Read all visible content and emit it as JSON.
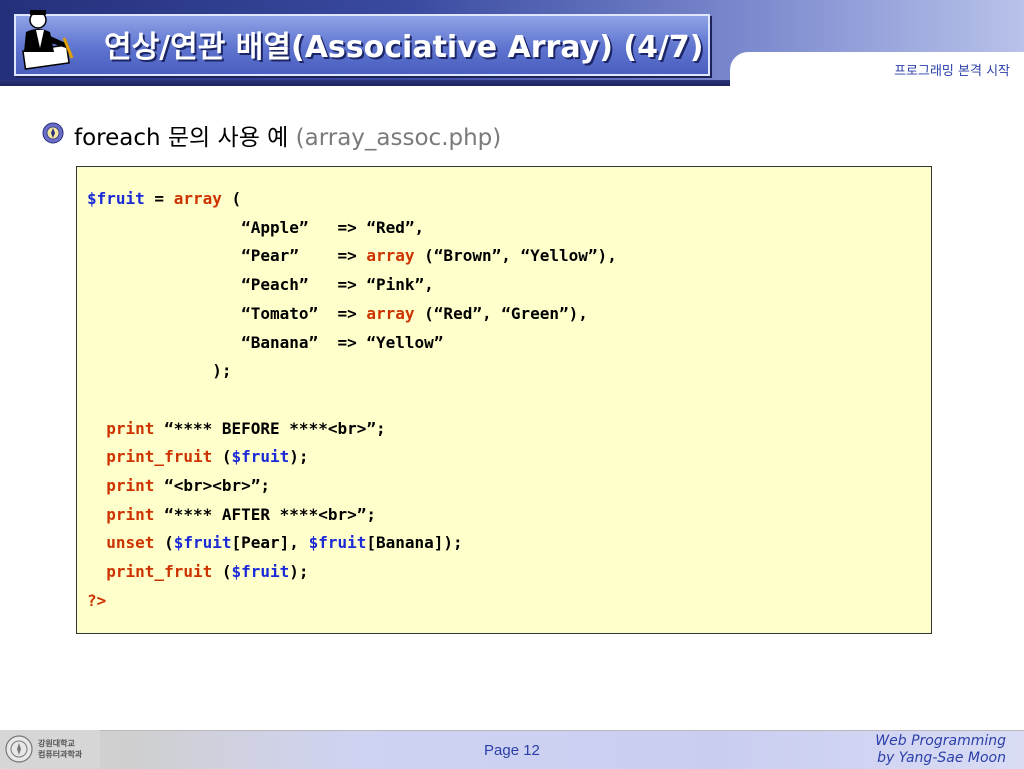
{
  "header": {
    "title": "연상/연관 배열(Associative Array) (4/7)",
    "subtitle": "프로그래밍 본격 시작"
  },
  "heading": {
    "text": "foreach 문의 사용 예",
    "file": "(array_assoc.php)"
  },
  "code_lines": [
    [
      {
        "t": "$fruit",
        "c": "var"
      },
      {
        "t": " = "
      },
      {
        "t": "array",
        "c": "kw"
      },
      {
        "t": " ("
      }
    ],
    [
      {
        "t": "                “Apple”   => “Red”,"
      }
    ],
    [
      {
        "t": "                “Pear”    => "
      },
      {
        "t": "array",
        "c": "kw"
      },
      {
        "t": " (“Brown”, “Yellow”),"
      }
    ],
    [
      {
        "t": "                “Peach”   => “Pink”,"
      }
    ],
    [
      {
        "t": "                “Tomato”  => "
      },
      {
        "t": "array",
        "c": "kw"
      },
      {
        "t": " (“Red”, “Green”),"
      }
    ],
    [
      {
        "t": "                “Banana”  => “Yellow”"
      }
    ],
    [
      {
        "t": "             );"
      }
    ],
    [
      {
        "t": ""
      }
    ],
    [
      {
        "t": "  "
      },
      {
        "t": "print",
        "c": "kw"
      },
      {
        "t": " “**** BEFORE ****<br>”;"
      }
    ],
    [
      {
        "t": "  "
      },
      {
        "t": "print_fruit",
        "c": "kw"
      },
      {
        "t": " ("
      },
      {
        "t": "$fruit",
        "c": "var"
      },
      {
        "t": ");"
      }
    ],
    [
      {
        "t": "  "
      },
      {
        "t": "print",
        "c": "kw"
      },
      {
        "t": " “<br><br>”;"
      }
    ],
    [
      {
        "t": "  "
      },
      {
        "t": "print",
        "c": "kw"
      },
      {
        "t": " “**** AFTER ****<br>”;"
      }
    ],
    [
      {
        "t": "  "
      },
      {
        "t": "unset",
        "c": "kw"
      },
      {
        "t": " ("
      },
      {
        "t": "$fruit",
        "c": "var"
      },
      {
        "t": "[Pear], "
      },
      {
        "t": "$fruit",
        "c": "var"
      },
      {
        "t": "[Banana]);"
      }
    ],
    [
      {
        "t": "  "
      },
      {
        "t": "print_fruit",
        "c": "kw"
      },
      {
        "t": " ("
      },
      {
        "t": "$fruit",
        "c": "var"
      },
      {
        "t": ");"
      }
    ],
    [
      {
        "t": "?>",
        "c": "kw"
      }
    ]
  ],
  "footer": {
    "dept_line1": "강원대학교",
    "dept_line2": "컴퓨터과학과",
    "page": "Page 12",
    "credit_line1": "Web Programming",
    "credit_line2": "by Yang-Sae Moon"
  },
  "colors": {
    "keyword": "#cc3300",
    "variable": "#1a2bd6",
    "code_background": "#ffffcc",
    "title_blue": "#4a5fbf"
  },
  "icons": {
    "logo": "person-writing-icon",
    "bullet": "university-seal-icon",
    "footer": "university-seal-icon"
  }
}
